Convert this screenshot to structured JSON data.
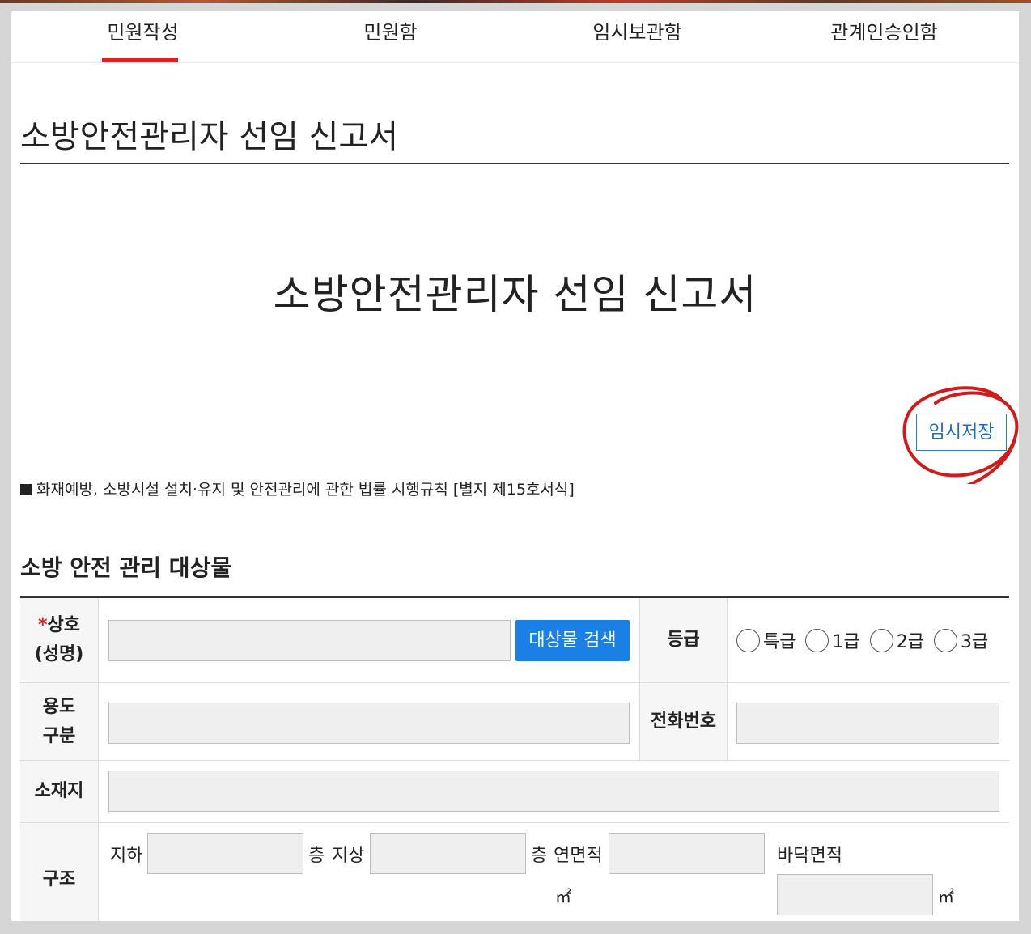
{
  "tabs": [
    {
      "label": "민원작성",
      "active": true
    },
    {
      "label": "민원함",
      "active": false
    },
    {
      "label": "임시보관함",
      "active": false
    },
    {
      "label": "관계인승인함",
      "active": false
    }
  ],
  "page_title": "소방안전관리자 선임 신고서",
  "document_title": "소방안전관리자 선임 신고서",
  "save_button": "임시저장",
  "law_note": "화재예방, 소방시설 설치·유지 및 안전관리에 관한 법률 시행규칙 [별지 제15호서식]",
  "section_title": "소방 안전 관리 대상물",
  "form": {
    "name_label_required": "*",
    "name_label_line1": "상호",
    "name_label_line2": "(성명)",
    "name_value": "",
    "search_button": "대상물 검색",
    "grade_label": "등급",
    "grade_options": [
      "특급",
      "1급",
      "2급",
      "3급"
    ],
    "usage_label_line1": "용도",
    "usage_label_line2": "구분",
    "usage_value": "",
    "phone_label": "전화번호",
    "phone_value": "",
    "address_label": "소재지",
    "address_value": "",
    "structure_label": "구조",
    "basement_label": "지하",
    "floor_unit": "층",
    "above_label": "지상",
    "total_area_label": "연면적",
    "floor_area_label": "바닥면적",
    "area_unit": "㎡"
  },
  "colors": {
    "accent_red": "#e02020",
    "primary_blue": "#1a80e6"
  }
}
